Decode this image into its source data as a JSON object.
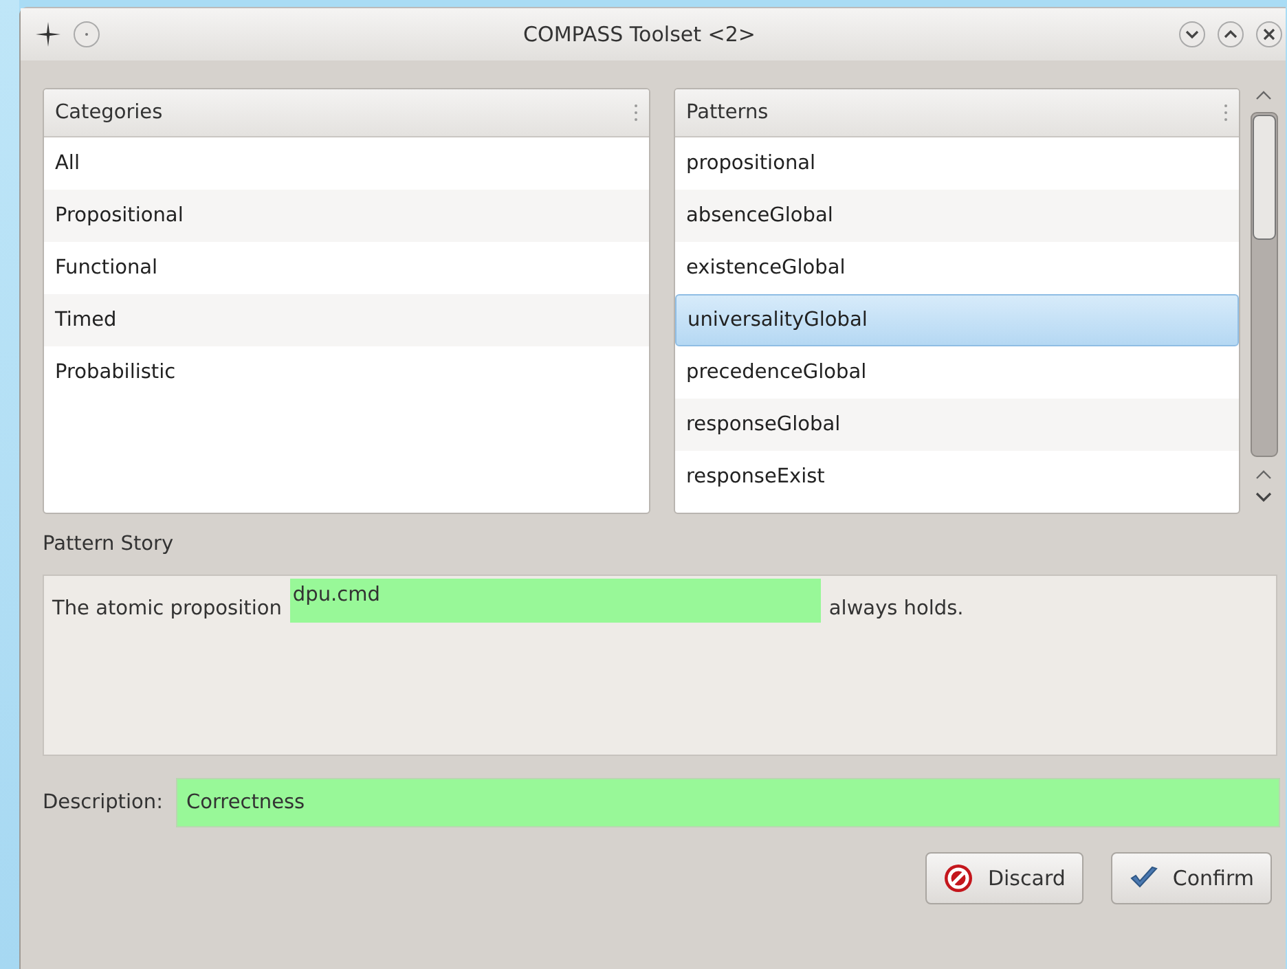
{
  "window": {
    "title": "COMPASS Toolset <2>"
  },
  "categories": {
    "header": "Categories",
    "items": [
      {
        "label": "All",
        "selected": false
      },
      {
        "label": "Propositional",
        "selected": false
      },
      {
        "label": "Functional",
        "selected": false
      },
      {
        "label": "Timed",
        "selected": false
      },
      {
        "label": "Probabilistic",
        "selected": false
      }
    ]
  },
  "patterns": {
    "header": "Patterns",
    "items": [
      {
        "label": "propositional",
        "selected": false
      },
      {
        "label": "absenceGlobal",
        "selected": false
      },
      {
        "label": "existenceGlobal",
        "selected": false
      },
      {
        "label": "universalityGlobal",
        "selected": true
      },
      {
        "label": "precedenceGlobal",
        "selected": false
      },
      {
        "label": "responseGlobal",
        "selected": false
      },
      {
        "label": "responseExist",
        "selected": false
      }
    ]
  },
  "story": {
    "label": "Pattern Story",
    "before": "The atomic proposition",
    "value": "dpu.cmd",
    "after": "always holds."
  },
  "description": {
    "label": "Description:",
    "value": "Correctness"
  },
  "buttons": [
    {
      "label": "Discard",
      "kind": "discard"
    },
    {
      "label": "Confirm",
      "kind": "confirm"
    }
  ]
}
